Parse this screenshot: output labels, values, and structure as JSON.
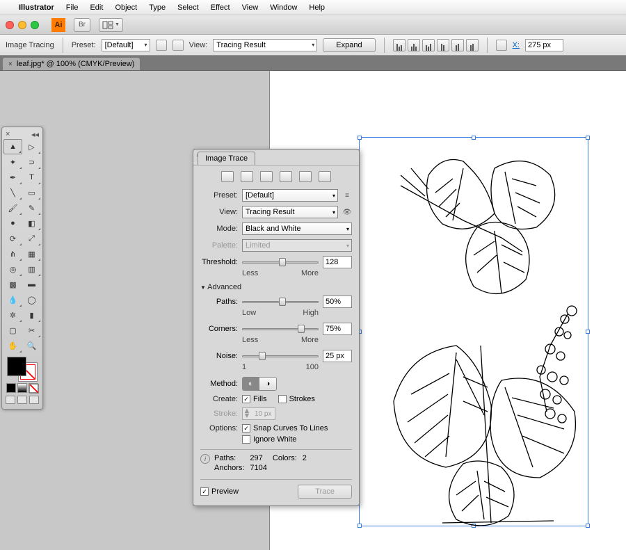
{
  "menubar": {
    "app_name": "Illustrator",
    "items": [
      "File",
      "Edit",
      "Object",
      "Type",
      "Select",
      "Effect",
      "View",
      "Window",
      "Help"
    ]
  },
  "titlebar": {
    "ai": "Ai",
    "br": "Br"
  },
  "controlbar": {
    "label": "Image Tracing",
    "preset_label": "Preset:",
    "preset_value": "[Default]",
    "view_label": "View:",
    "view_value": "Tracing Result",
    "expand": "Expand",
    "x_label": "X:",
    "x_value": "275 px"
  },
  "doc_tab": {
    "title": "leaf.jpg* @ 100% (CMYK/Preview)"
  },
  "panel": {
    "title": "Image Trace",
    "preset_label": "Preset:",
    "preset_value": "[Default]",
    "view_label": "View:",
    "view_value": "Tracing Result",
    "mode_label": "Mode:",
    "mode_value": "Black and White",
    "palette_label": "Palette:",
    "palette_value": "Limited",
    "threshold": {
      "label": "Threshold:",
      "value": "128",
      "min": "Less",
      "max": "More"
    },
    "advanced": "Advanced",
    "paths": {
      "label": "Paths:",
      "value": "50%",
      "min": "Low",
      "max": "High"
    },
    "corners": {
      "label": "Corners:",
      "value": "75%",
      "min": "Less",
      "max": "More"
    },
    "noise": {
      "label": "Noise:",
      "value": "25 px",
      "min": "1",
      "max": "100"
    },
    "method_label": "Method:",
    "create_label": "Create:",
    "fills_label": "Fills",
    "strokes_label": "Strokes",
    "stroke_label": "Stroke:",
    "stroke_value": "10 px",
    "options_label": "Options:",
    "snap_label": "Snap Curves To Lines",
    "ignore_label": "Ignore White",
    "info": {
      "paths_label": "Paths:",
      "paths_value": "297",
      "colors_label": "Colors:",
      "colors_value": "2",
      "anchors_label": "Anchors:",
      "anchors_value": "7104"
    },
    "preview_label": "Preview",
    "trace_btn": "Trace"
  }
}
